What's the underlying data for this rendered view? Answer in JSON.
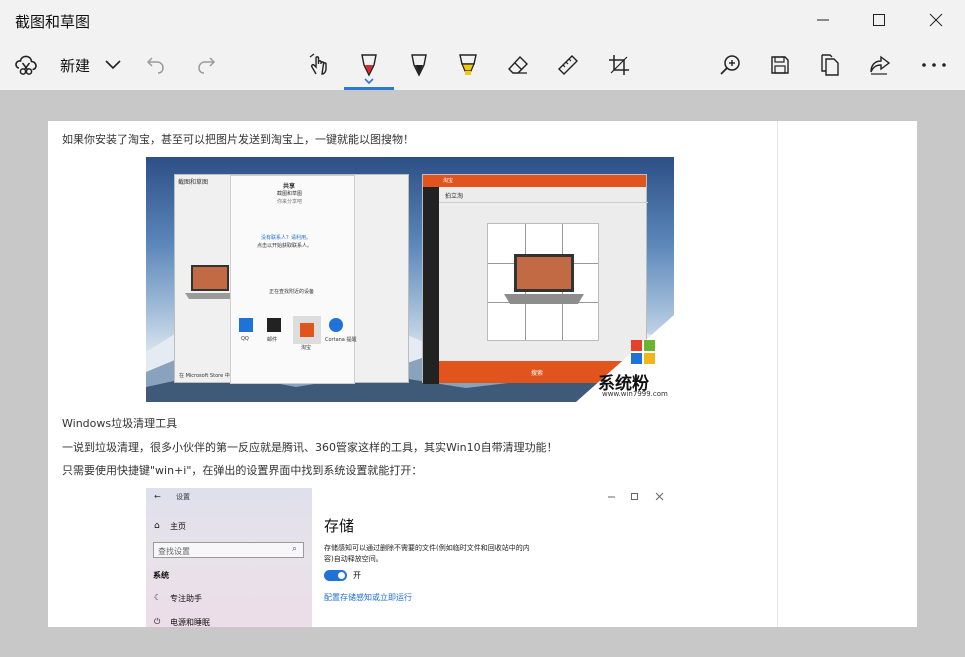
{
  "window": {
    "title": "截图和草图"
  },
  "toolbar": {
    "new_label": "新建"
  },
  "icons": {
    "minimize": "minimize-icon",
    "maximize": "maximize-icon",
    "close": "close-icon",
    "new": "snip-new-icon",
    "dropdown": "chevron-down-icon",
    "undo": "undo-icon",
    "redo": "redo-icon",
    "touch": "touch-writing-icon",
    "ballpoint": "ballpoint-pen-icon",
    "pencil": "pencil-icon",
    "highlighter": "highlighter-icon",
    "eraser": "eraser-icon",
    "ruler": "ruler-icon",
    "crop": "crop-icon",
    "zoom": "zoom-in-icon",
    "save": "save-icon",
    "copy": "copy-icon",
    "share": "share-icon",
    "more": "more-icon"
  },
  "colors": {
    "active_tool": "#2b79d6",
    "ballpoint_tip": "#d92b2b",
    "highlighter": "#f2c811",
    "taobao_orange": "#e2541d",
    "settings_toggle": "#1f73d6",
    "link": "#1f6fd0"
  },
  "document": {
    "line1": "如果你安装了淘宝，甚至可以把图片发送到淘宝上，一键就能以图搜物！",
    "line2": "Windows垃圾清理工具",
    "line3": "一说到垃圾清理，很多小伙伴的第一反应就是腾讯、360管家这样的工具，其实Win10自带清理功能！",
    "line4": "只需要使用快捷键\"win+i\"，在弹出的设置界面中找到系统设置就能打开："
  },
  "screenshot1": {
    "left_window_title": "截图和草图",
    "share_title": "共享",
    "share_sub1": "截图和草图",
    "share_sub2": "你来分享吧",
    "no_contacts": "没有联系人？请利用。",
    "no_contacts_sub": "点击以开始获取联系人。",
    "nearby": "正在查找附近的设备",
    "apps": [
      "QQ",
      "邮件",
      "淘宝",
      "Cortana 提醒"
    ],
    "store_link": "在 Microsoft Store 中获取应用",
    "taobao_window_title": "淘宝",
    "taobao_header": "拍立淘",
    "search_button": "搜索",
    "brand_name": "系统粉",
    "brand_url": "www.win7999.com"
  },
  "screenshot2": {
    "back_label": "设置",
    "home": "主页",
    "search_placeholder": "查找设置",
    "section": "系统",
    "item1": "专注助手",
    "item2": "电源和睡眠",
    "heading": "存储",
    "description_l1": "存储感知可以通过删除不需要的文件(例如临时文件和回收站中的内",
    "description_l2": "容)自动释放空间。",
    "toggle_label": "开",
    "link": "配置存储感知或立即运行"
  }
}
